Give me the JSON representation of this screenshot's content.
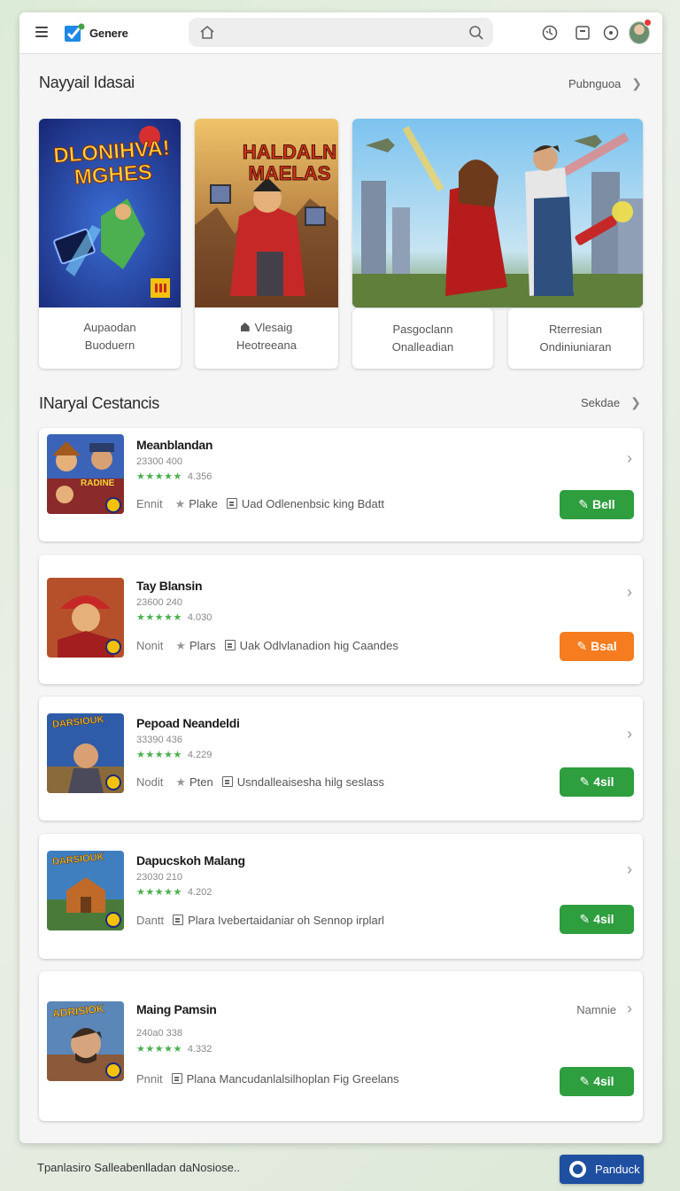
{
  "app": {
    "brand": "Genere"
  },
  "search": {
    "value": "",
    "placeholder": ""
  },
  "featured": {
    "title": "Nayyail Idasai",
    "link": "Pubnguoa",
    "cards": [
      {
        "art_title": "DLONIHVA! MGHES",
        "line1": "Aupaodan",
        "line2": "Buoduern"
      },
      {
        "art_title": "HALDALN MAELAS",
        "line1": "Vlesaig",
        "line2": "Heotreeana"
      },
      {
        "line1": "Pasgoclann",
        "line2": "Onalleadian"
      },
      {
        "line1": "Rterresian",
        "line2": "Ondiniuniaran"
      }
    ]
  },
  "list": {
    "title": "INaryal Cestancis",
    "link": "Sekdae",
    "games": [
      {
        "name": "Meanblandan",
        "sub": "23300 400",
        "stars": "★★★★★",
        "rating": "4.356",
        "category": "Ennit",
        "platform": "Plake",
        "desc": "Uad Odlenenbsic king Bdatt",
        "button": "Bell",
        "thumb_text": "RADINE"
      },
      {
        "name": "Tay Blansin",
        "sub": "23600 240",
        "stars": "★★★★★",
        "rating": "4.030",
        "category": "Nonit",
        "platform": "Plars",
        "desc": "Uak Odlvlanadion hig Caandes",
        "button": "Bsal"
      },
      {
        "name": "Pepoad Neandeldi",
        "sub": "33390 436",
        "stars": "★★★★★",
        "rating": "4.229",
        "category": "Nodit",
        "platform": "Pten",
        "desc": "Usndalleaisesha hilg seslass",
        "button": "4sil",
        "thumb_text": "DARSIOUK"
      },
      {
        "name": "Dapucskoh Malang",
        "sub": "23030 210",
        "stars": "★★★★★",
        "rating": "4.202",
        "category": "Dantt",
        "platform": "",
        "desc": "Plara Ivebertaidaniar oh Sennop irplarl",
        "button": "4sil",
        "thumb_text": "DARSIOUK"
      },
      {
        "name": "Maing Pamsin",
        "sub": "240a0 338",
        "stars": "★★★★★",
        "rating": "4.332",
        "category": "Pnnit",
        "platform": "",
        "desc": "Plana Mancudanlalsilhoplan Fig Greelans",
        "button": "4sil",
        "side": "Namnie",
        "thumb_text": "ADRISIOK"
      }
    ]
  },
  "footer": {
    "text": "Tpanlasiro Salleabenlladan daNosiose..",
    "button": "Panduck"
  },
  "colors": {
    "green": "#2e9e3e",
    "orange": "#f57c1f",
    "blue": "#1f4fa0"
  }
}
